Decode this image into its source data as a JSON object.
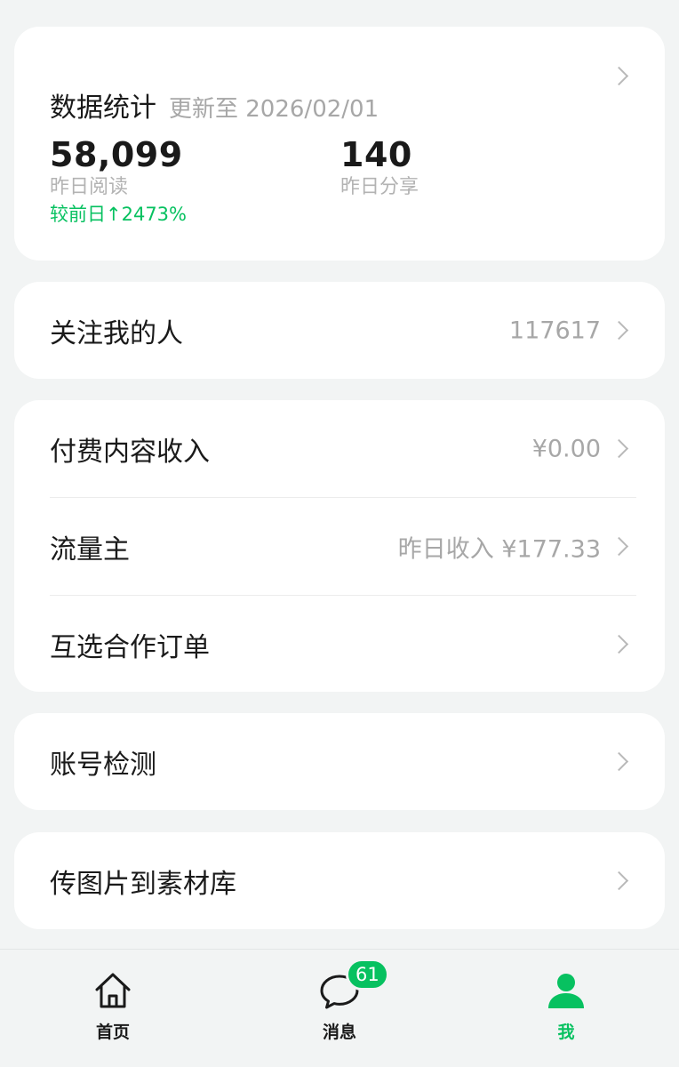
{
  "stats": {
    "title": "数据统计",
    "updated": "更新至 2026/02/01",
    "read": {
      "value": "58,099",
      "label": "昨日阅读",
      "change": "较前日↑2473%"
    },
    "share": {
      "value": "140",
      "label": "昨日分享"
    }
  },
  "followers": {
    "label": "关注我的人",
    "value": "117617"
  },
  "income": {
    "rows": [
      {
        "label": "付费内容收入",
        "value": "¥0.00"
      },
      {
        "label": "流量主",
        "value": "昨日收入 ¥177.33"
      },
      {
        "label": "互选合作订单",
        "value": ""
      }
    ]
  },
  "account": {
    "label": "账号检测"
  },
  "upload": {
    "label": "传图片到素材库"
  },
  "tabbar": {
    "home": {
      "label": "首页",
      "icon": "home-icon"
    },
    "messages": {
      "label": "消息",
      "icon": "chat-bubble-icon",
      "badge": "61"
    },
    "me": {
      "label": "我",
      "icon": "person-icon"
    }
  },
  "colors": {
    "accent": "#07c160",
    "background": "#f2f4f4",
    "card": "#ffffff",
    "muted": "#a7a7a7"
  }
}
